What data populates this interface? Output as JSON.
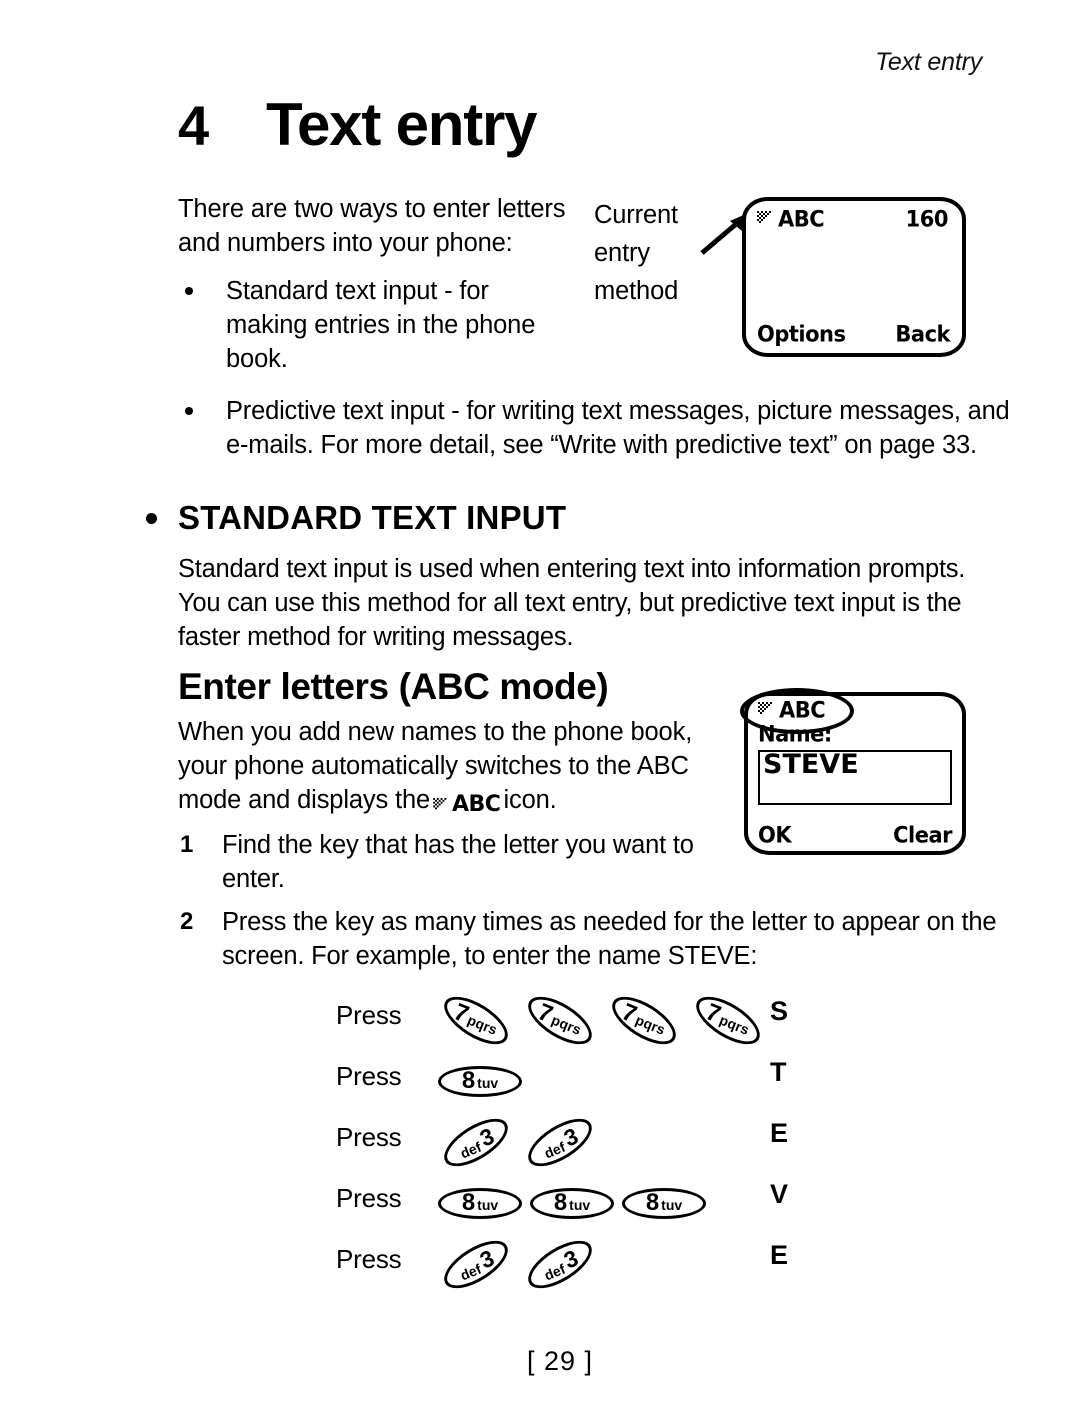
{
  "running_head": "Text entry",
  "chapter": {
    "number": "4",
    "title": "Text entry"
  },
  "intro": {
    "lead": "There are two ways to enter letters and numbers into your phone:",
    "bullet_1": "Standard text input - for making entries in the phone book.",
    "bullet_2": "Predictive text input - for writing text messages, picture messages, and e-mails. For more detail, see “Write with predictive text” on page 33."
  },
  "callout": {
    "text": "Current entry method"
  },
  "section": {
    "heading": "STANDARD TEXT INPUT",
    "paragraph": "Standard text input is used when entering text into information prompts. You can use this method for all text entry, but predictive text input is the faster method for writing messages."
  },
  "subsection": {
    "heading": "Enter letters (ABC mode)",
    "paragraph_before_icon": "When you add new names to the phone book, your phone automatically switches to the ABC mode and displays the",
    "icon_name": "abc-indicator-icon",
    "paragraph_after_icon": "icon."
  },
  "steps": [
    {
      "number": "1",
      "text": "Find the key that has the letter you want to enter."
    },
    {
      "number": "2",
      "text": "Press the key as many times as needed for the letter to appear on the screen. For example, to enter the name STEVE:"
    }
  ],
  "phone_screen_1": {
    "status_icon": "abc-indicator-icon",
    "status": "ABC",
    "counter": "160",
    "softkey_left": "Options",
    "softkey_right": "Back"
  },
  "phone_screen_2": {
    "status_icon": "abc-indicator-icon",
    "status": "ABC",
    "prompt": "Name:",
    "input_value": "STEVE",
    "softkey_left": "OK",
    "softkey_right": "Clear"
  },
  "press_table": {
    "rows": [
      {
        "label": "Press",
        "keys": [
          {
            "digit": "7",
            "letters": "pqrs"
          },
          {
            "digit": "7",
            "letters": "pqrs"
          },
          {
            "digit": "7",
            "letters": "pqrs"
          },
          {
            "digit": "7",
            "letters": "pqrs"
          }
        ],
        "result": "S"
      },
      {
        "label": "Press",
        "keys": [
          {
            "digit": "8",
            "letters": "tuv"
          }
        ],
        "result": "T"
      },
      {
        "label": "Press",
        "keys": [
          {
            "digit": "3",
            "letters": "def"
          },
          {
            "digit": "3",
            "letters": "def"
          }
        ],
        "result": "E"
      },
      {
        "label": "Press",
        "keys": [
          {
            "digit": "8",
            "letters": "tuv"
          },
          {
            "digit": "8",
            "letters": "tuv"
          },
          {
            "digit": "8",
            "letters": "tuv"
          }
        ],
        "result": "V"
      },
      {
        "label": "Press",
        "keys": [
          {
            "digit": "3",
            "letters": "def"
          },
          {
            "digit": "3",
            "letters": "def"
          }
        ],
        "result": "E"
      }
    ]
  },
  "folio": "[ 29 ]"
}
